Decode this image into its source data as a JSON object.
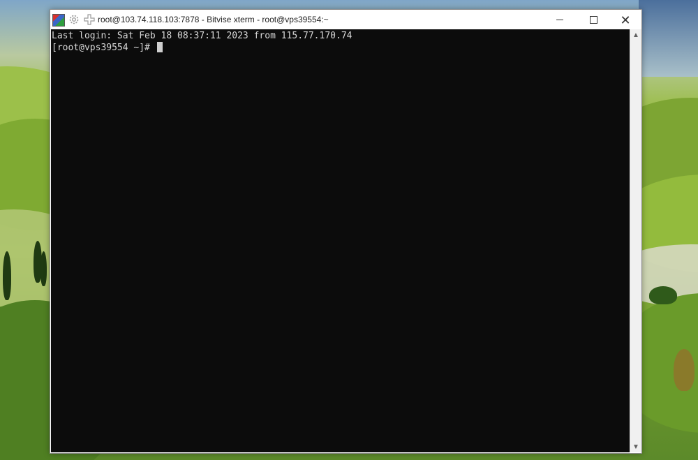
{
  "window": {
    "title": "root@103.74.118.103:7878 - Bitvise xterm - root@vps39554:~",
    "icons": {
      "app": "bitvise-app-icon",
      "settings": "gear-icon",
      "new": "plus-icon",
      "minimize": "minimize-icon",
      "maximize": "maximize-icon",
      "close": "close-icon"
    },
    "close_glyph": "✕"
  },
  "terminal": {
    "lines": [
      "Last login: Sat Feb 18 08:37:11 2023 from 115.77.170.74",
      "[root@vps39554 ~]# "
    ],
    "background": "#0c0c0c",
    "foreground": "#d9d9d9"
  },
  "scrollbar": {
    "up_glyph": "▲",
    "down_glyph": "▼"
  }
}
